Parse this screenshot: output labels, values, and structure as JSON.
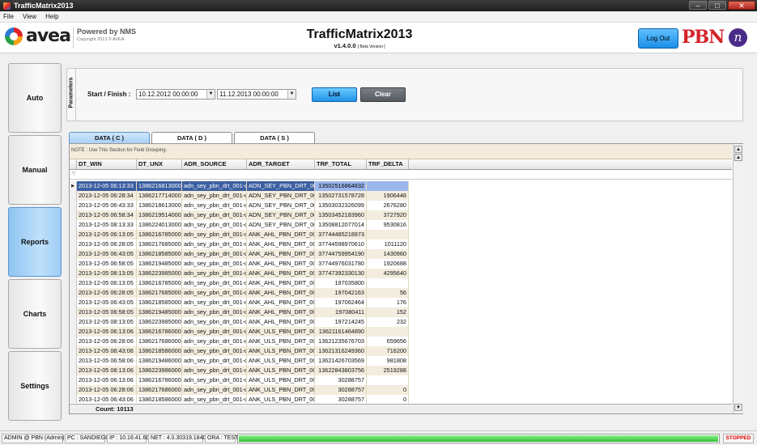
{
  "window": {
    "title": "TrafficMatrix2013",
    "buttons": [
      "–",
      "□",
      "✕"
    ]
  },
  "menu": [
    "File",
    "View",
    "Help"
  ],
  "header": {
    "avea_text": "avea",
    "powered_by": "Powered by NMS",
    "copyright": "Copyright 2013 © AVEA",
    "app_title": "TrafficMatrix2013",
    "version": "v1.4.0.0",
    "version_tag": "[ Beta Version ]",
    "logout_label": "Log Out",
    "pbn_text": "PBN",
    "pbn_mark": "n"
  },
  "nav": [
    "Auto",
    "Manual",
    "Reports",
    "Charts",
    "Settings"
  ],
  "nav_active": "Reports",
  "parameters": {
    "title": "Parameters",
    "label": "Start / Finish :",
    "start": "10.12.2012 00:00:00",
    "finish": "11.12.2013 00:00:00",
    "list_label": "List",
    "clear_label": "Clear"
  },
  "tabs": [
    "DATA  ( C )",
    "DATA  ( D )",
    "DATA  ( S )"
  ],
  "grid": {
    "note": "NOTE :  Use This Section for Field Grouping.",
    "columns": [
      "DT_WIN",
      "DT_UNX",
      "ADR_SOURCE",
      "ADR_TARGET",
      "TRF_TOTAL",
      "TRF_DELTA"
    ],
    "rows": [
      [
        "2013-12-05  06:13:33",
        "1386216813000",
        "adn_sey_pbn_drt_001-c",
        "ADN_SEY_PBN_DRT_002",
        "13502516864832",
        ""
      ],
      [
        "2013-12-05  06:28:34",
        "1386217714000",
        "adn_sey_pbn_drt_001-c",
        "ADN_SEY_PBN_DRT_002",
        "13502731578728",
        "1906448"
      ],
      [
        "2013-12-05  06:43:33",
        "1386218613000",
        "adn_sey_pbn_drt_001-c",
        "ADN_SEY_PBN_DRT_002",
        "13503032326099",
        "2676280"
      ],
      [
        "2013-12-05  06:58:34",
        "1386219514000",
        "adn_sey_pbn_drt_001-c",
        "ADN_SEY_PBN_DRT_002",
        "13503452183960",
        "3727920"
      ],
      [
        "2013-12-05  08:13:33",
        "1386224013000",
        "adn_sey_pbn_drt_001-c",
        "ADN_SEY_PBN_DRT_002",
        "13508812077014",
        "9530816"
      ],
      [
        "2013-12-05  06:13:05",
        "1386216785000",
        "adn_sey_pbn_drt_001-c",
        "ANK_AHL_PBN_DRT_001",
        "37744485218973",
        ""
      ],
      [
        "2013-12-05  06:28:05",
        "1386217685000",
        "adn_sey_pbn_drt_001-c",
        "ANK_AHL_PBN_DRT_001",
        "37744598970610",
        "1011120"
      ],
      [
        "2013-12-05  06:43:05",
        "1386218585000",
        "adn_sey_pbn_drt_001-c",
        "ANK_AHL_PBN_DRT_001",
        "37744759954190",
        "1430960"
      ],
      [
        "2013-12-05  06:58:05",
        "1386219485000",
        "adn_sey_pbn_drt_001-c",
        "ANK_AHL_PBN_DRT_001",
        "37744976031780",
        "1920688"
      ],
      [
        "2013-12-05  08:13:05",
        "1386223985000",
        "adn_sey_pbn_drt_001-c",
        "ANK_AHL_PBN_DRT_001",
        "37747392330130",
        "4295640"
      ],
      [
        "2013-12-05  06:13:05",
        "1386216785000",
        "adn_sey_pbn_drt_001-c",
        "ANK_AHL_PBN_DRT_002",
        "197035800",
        ""
      ],
      [
        "2013-12-05  06:28:05",
        "1386217685000",
        "adn_sey_pbn_drt_001-c",
        "ANK_AHL_PBN_DRT_002",
        "197042163",
        "56"
      ],
      [
        "2013-12-05  06:43:05",
        "1386218585000",
        "adn_sey_pbn_drt_001-c",
        "ANK_AHL_PBN_DRT_002",
        "197062464",
        "176"
      ],
      [
        "2013-12-05  06:58:05",
        "1386219485000",
        "adn_sey_pbn_drt_001-c",
        "ANK_AHL_PBN_DRT_002",
        "197080411",
        "152"
      ],
      [
        "2013-12-05  08:13:05",
        "1386223985000",
        "adn_sey_pbn_drt_001-c",
        "ANK_AHL_PBN_DRT_002",
        "197214245",
        "232"
      ],
      [
        "2013-12-05  06:13:06",
        "1386216786000",
        "adn_sey_pbn_drt_001-c",
        "ANK_ULS_PBN_DRT_001",
        "13621161464890",
        ""
      ],
      [
        "2013-12-05  06:28:06",
        "1386217686000",
        "adn_sey_pbn_drt_001-c",
        "ANK_ULS_PBN_DRT_001",
        "13621235676703",
        "659656"
      ],
      [
        "2013-12-05  06:43:06",
        "1386218586000",
        "adn_sey_pbn_drt_001-c",
        "ANK_ULS_PBN_DRT_001",
        "13621316249360",
        "716200"
      ],
      [
        "2013-12-05  06:58:06",
        "1386219486000",
        "adn_sey_pbn_drt_001-c",
        "ANK_ULS_PBN_DRT_001",
        "13621426703569",
        "981808"
      ],
      [
        "2013-12-05  08:13:06",
        "1386223986000",
        "adn_sey_pbn_drt_001-c",
        "ANK_ULS_PBN_DRT_001",
        "13622843803756",
        "2519288"
      ],
      [
        "2013-12-05  06:13:06",
        "1386216786000",
        "adn_sey_pbn_drt_001-c",
        "ANK_ULS_PBN_DRT_002",
        "30288757",
        ""
      ],
      [
        "2013-12-05  06:28:06",
        "1386217686000",
        "adn_sey_pbn_drt_001-c",
        "ANK_ULS_PBN_DRT_002",
        "30288757",
        "0"
      ],
      [
        "2013-12-05  06:43:06",
        "1386218586000",
        "adn_sey_pbn_drt_001-c",
        "ANK_ULS_PBN_DRT_002",
        "30288757",
        "0"
      ]
    ],
    "count_label": "Count: 10113"
  },
  "status": {
    "user": "ADMIN @ PBN (Admin)",
    "pc": "PC : SANDIEGO",
    "ip": "IP : 10.16.41.60",
    "net": "NET : 4.0.30319.18408",
    "ora": "ORA : TEST",
    "progress": 1.0,
    "state": "STOPPED"
  }
}
